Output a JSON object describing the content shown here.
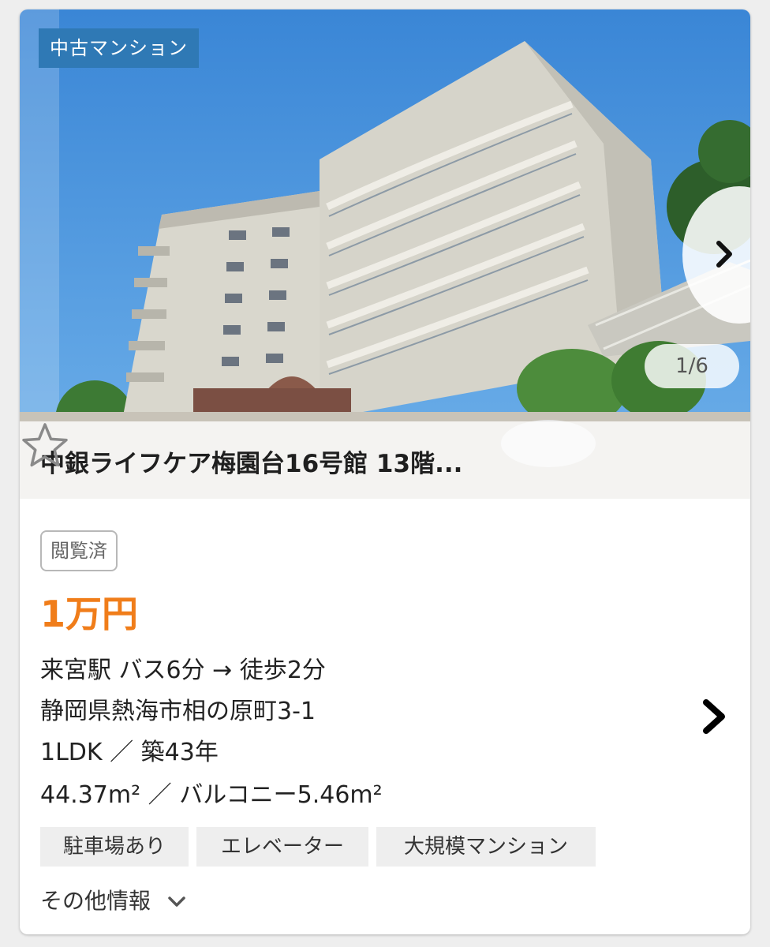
{
  "listing": {
    "property_type": "中古マンション",
    "photo_counter": "1/6",
    "title": "中銀ライフケア梅園台16号館 13階...",
    "viewed_badge": "閲覧済",
    "price": "1万円",
    "access": "来宮駅 バス6分 → 徒歩2分",
    "address": "静岡県熱海市相の原町3-1",
    "layout_age": "1LDK ／ 築43年",
    "area": "44.37m² ／ バルコニー5.46m²",
    "tags": [
      "駐車場あり",
      "エレベーター",
      "大規模マンション"
    ],
    "more_info": "その他情報"
  },
  "icons": {
    "next_photo": "chevron-right-icon",
    "favorite": "star-outline-icon",
    "detail": "chevron-right-icon",
    "more_toggle": "chevron-down-icon"
  },
  "colors": {
    "badge": "#2f79b5",
    "price": "#f07d1a",
    "sky": "#3f8fd8",
    "building": "#d8d6cc"
  }
}
